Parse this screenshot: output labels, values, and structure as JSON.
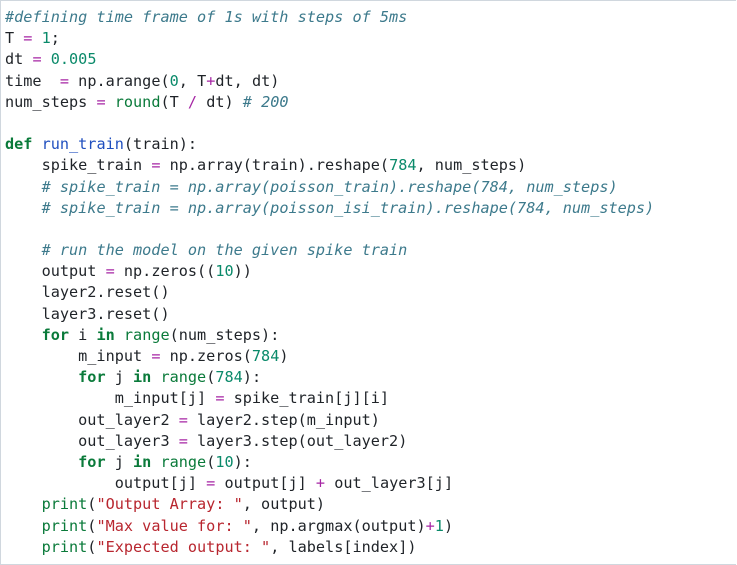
{
  "code_lines": [
    "#defining time frame of 1s with steps of 5ms",
    "T = 1;",
    "dt = 0.005",
    "time  = np.arange(0, T+dt, dt)",
    "num_steps = round(T / dt) # 200",
    "",
    "def run_train(train):",
    "    spike_train = np.array(train).reshape(784, num_steps)",
    "    # spike_train = np.array(poisson_train).reshape(784, num_steps)",
    "    # spike_train = np.array(poisson_isi_train).reshape(784, num_steps)",
    "",
    "    # run the model on the given spike train",
    "    output = np.zeros((10))",
    "    layer2.reset()",
    "    layer3.reset()",
    "    for i in range(num_steps):",
    "        m_input = np.zeros(784)",
    "        for j in range(784):",
    "            m_input[j] = spike_train[j][i]",
    "        out_layer2 = layer2.step(m_input)",
    "        out_layer3 = layer3.step(out_layer2)",
    "        for j in range(10):",
    "            output[j] = output[j] + out_layer3[j]",
    "    print(\"Output Array: \", output)",
    "    print(\"Max value for: \", np.argmax(output)+1)",
    "    print(\"Expected output: \", labels[index])"
  ],
  "colors": {
    "comment": "#3d7a8c",
    "keyword": "#0a7a3a",
    "number": "#0a8a6a",
    "string": "#b8262f",
    "operator": "#a626a4",
    "function_name": "#1f4fbf"
  }
}
